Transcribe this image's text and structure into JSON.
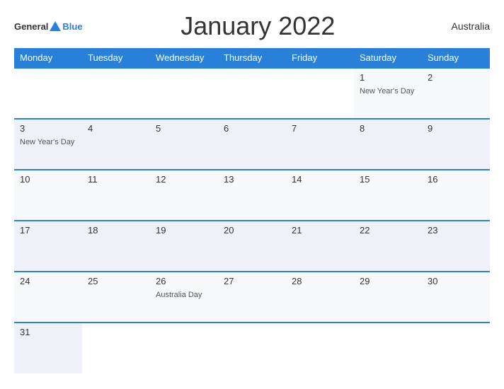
{
  "header": {
    "logo_general": "General",
    "logo_blue": "Blue",
    "title": "January 2022",
    "country": "Australia"
  },
  "weekdays": [
    "Monday",
    "Tuesday",
    "Wednesday",
    "Thursday",
    "Friday",
    "Saturday",
    "Sunday"
  ],
  "weeks": [
    [
      {
        "day": "",
        "event": "",
        "empty": true
      },
      {
        "day": "",
        "event": "",
        "empty": true
      },
      {
        "day": "",
        "event": "",
        "empty": true
      },
      {
        "day": "",
        "event": "",
        "empty": true
      },
      {
        "day": "",
        "event": "",
        "empty": true
      },
      {
        "day": "1",
        "event": "New Year's Day"
      },
      {
        "day": "2",
        "event": ""
      }
    ],
    [
      {
        "day": "3",
        "event": "New Year's Day"
      },
      {
        "day": "4",
        "event": ""
      },
      {
        "day": "5",
        "event": ""
      },
      {
        "day": "6",
        "event": ""
      },
      {
        "day": "7",
        "event": ""
      },
      {
        "day": "8",
        "event": ""
      },
      {
        "day": "9",
        "event": ""
      }
    ],
    [
      {
        "day": "10",
        "event": ""
      },
      {
        "day": "11",
        "event": ""
      },
      {
        "day": "12",
        "event": ""
      },
      {
        "day": "13",
        "event": ""
      },
      {
        "day": "14",
        "event": ""
      },
      {
        "day": "15",
        "event": ""
      },
      {
        "day": "16",
        "event": ""
      }
    ],
    [
      {
        "day": "17",
        "event": ""
      },
      {
        "day": "18",
        "event": ""
      },
      {
        "day": "19",
        "event": ""
      },
      {
        "day": "20",
        "event": ""
      },
      {
        "day": "21",
        "event": ""
      },
      {
        "day": "22",
        "event": ""
      },
      {
        "day": "23",
        "event": ""
      }
    ],
    [
      {
        "day": "24",
        "event": ""
      },
      {
        "day": "25",
        "event": ""
      },
      {
        "day": "26",
        "event": "Australia Day"
      },
      {
        "day": "27",
        "event": ""
      },
      {
        "day": "28",
        "event": ""
      },
      {
        "day": "29",
        "event": ""
      },
      {
        "day": "30",
        "event": ""
      }
    ],
    [
      {
        "day": "31",
        "event": ""
      },
      {
        "day": "",
        "event": "",
        "empty": true
      },
      {
        "day": "",
        "event": "",
        "empty": true
      },
      {
        "day": "",
        "event": "",
        "empty": true
      },
      {
        "day": "",
        "event": "",
        "empty": true
      },
      {
        "day": "",
        "event": "",
        "empty": true
      },
      {
        "day": "",
        "event": "",
        "empty": true
      }
    ]
  ]
}
